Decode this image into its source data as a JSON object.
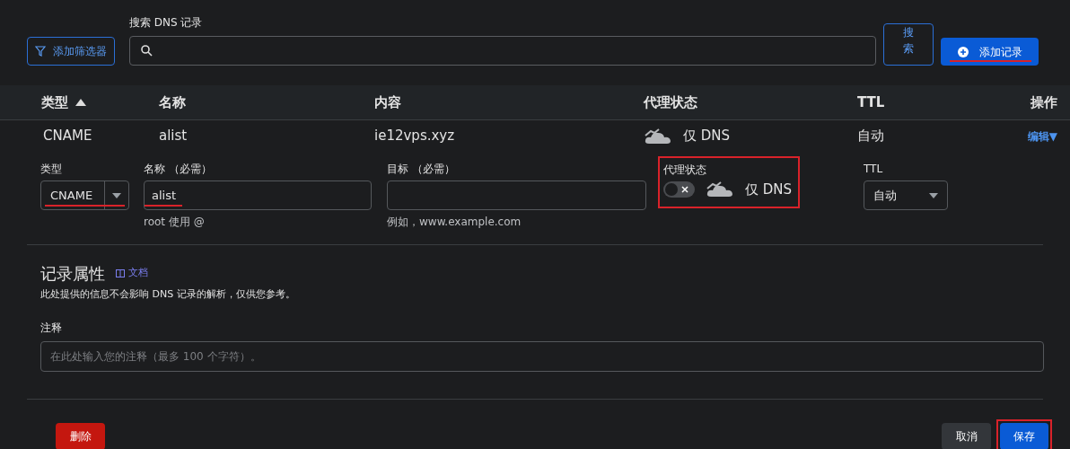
{
  "toolbar": {
    "filter_button": "添加筛选器",
    "search_label": "搜索 DNS 记录",
    "search_button": "搜索",
    "add_button": {
      "label": "添加记录",
      "annotated": true
    }
  },
  "table": {
    "columns": [
      {
        "label": "类型",
        "sorted": true
      },
      {
        "label": "名称",
        "sorted": false
      },
      {
        "label": "内容",
        "sorted": false
      },
      {
        "label": "代理状态",
        "sorted": false
      },
      {
        "label": "TTL",
        "sorted": false
      },
      {
        "label": "操作",
        "sorted": false
      }
    ],
    "rows": [
      {
        "type": "CNAME",
        "name": "alist",
        "content": "ie12vps.xyz",
        "proxy": "仅 DNS",
        "ttl": "自动",
        "action": "编辑▼"
      }
    ]
  },
  "edit_form": {
    "type": {
      "label": "类型",
      "value": "CNAME",
      "annotated": true
    },
    "name": {
      "label": "名称 （必需）",
      "value": "alist",
      "hint": "root 使用 @",
      "annotated": true
    },
    "target": {
      "label": "目标 （必需）",
      "hint": "例如，www.example.com"
    },
    "proxy": {
      "label": "代理状态",
      "on": false,
      "text": "仅 DNS",
      "annotated": true
    },
    "ttl": {
      "label": "TTL",
      "value": "自动"
    }
  },
  "record_attributes": {
    "title": "记录属性",
    "docs_link": "文档",
    "description": "此处提供的信息不会影响 DNS 记录的解析，仅供您参考。",
    "comment_label": "注释",
    "comment_placeholder": "在此处输入您的注释（最多 100 个字符）。"
  },
  "footer": {
    "delete_button": "删除",
    "cancel_button": "取消",
    "save_button": {
      "label": "保存",
      "annotated": true
    }
  }
}
